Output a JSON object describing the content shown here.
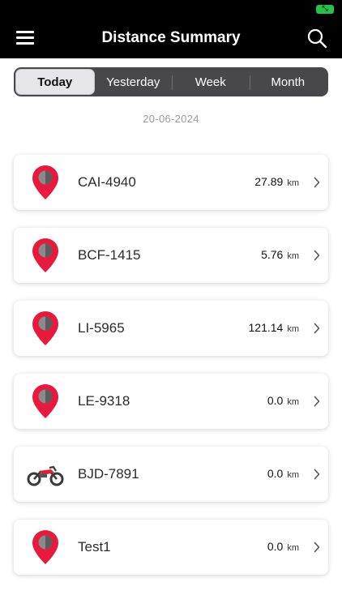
{
  "header": {
    "title": "Distance Summary"
  },
  "tabs": [
    {
      "label": "Today"
    },
    {
      "label": "Yesterday"
    },
    {
      "label": "Week"
    },
    {
      "label": "Month"
    }
  ],
  "selected_tab": "Today",
  "date": "20-06-2024",
  "colors": {
    "pin": "#e8193c",
    "header_bg": "#000000",
    "tab_bg": "#48484a",
    "battery": "#25c24a"
  },
  "vehicles": [
    {
      "name": "CAI-4940",
      "distance": "27.89",
      "unit": "km",
      "icon": "map-pin-icon"
    },
    {
      "name": "BCF-1415",
      "distance": "5.76",
      "unit": "km",
      "icon": "map-pin-icon"
    },
    {
      "name": "LI-5965",
      "distance": "121.14",
      "unit": "km",
      "icon": "map-pin-icon"
    },
    {
      "name": "LE-9318",
      "distance": "0.0",
      "unit": "km",
      "icon": "map-pin-icon"
    },
    {
      "name": "BJD-7891",
      "distance": "0.0",
      "unit": "km",
      "icon": "motorcycle-icon"
    },
    {
      "name": "Test1",
      "distance": "0.0",
      "unit": "km",
      "icon": "map-pin-icon"
    }
  ]
}
